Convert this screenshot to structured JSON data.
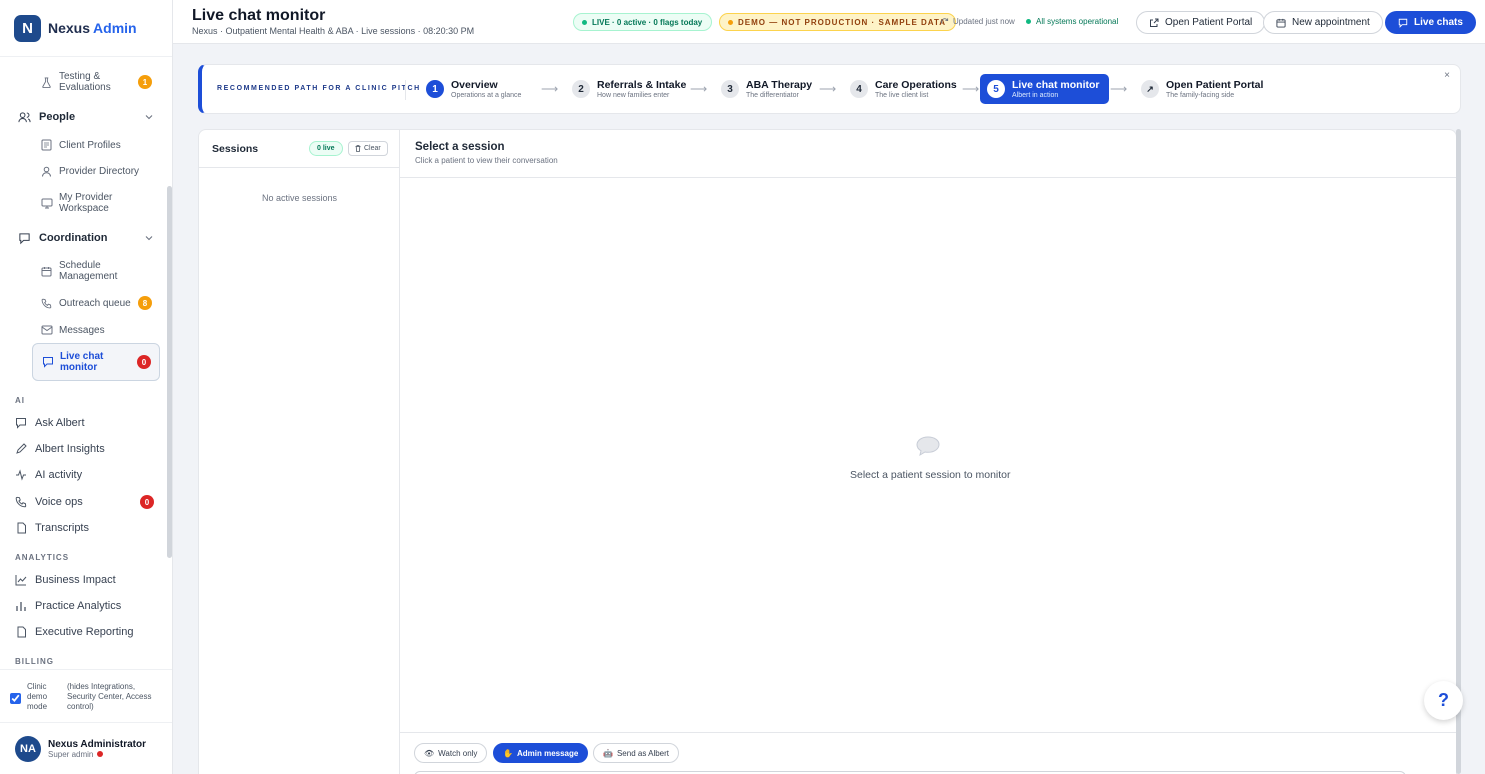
{
  "brand": {
    "logo_letter": "N",
    "name": "Nexus",
    "accent": "Admin"
  },
  "sidebar": {
    "testing": {
      "label": "Testing & Evaluations",
      "badge": "1"
    },
    "people": {
      "label": "People",
      "items": [
        {
          "label": "Client Profiles"
        },
        {
          "label": "Provider Directory"
        },
        {
          "label": "My Provider Workspace"
        }
      ]
    },
    "coordination": {
      "label": "Coordination",
      "items": [
        {
          "label": "Schedule Management"
        },
        {
          "label": "Outreach queue",
          "badge": "8"
        },
        {
          "label": "Messages"
        },
        {
          "label": "Live chat monitor",
          "badge": "0"
        }
      ]
    },
    "ai_label": "AI",
    "ai_items": [
      {
        "label": "Ask Albert"
      },
      {
        "label": "Albert Insights"
      },
      {
        "label": "AI activity"
      },
      {
        "label": "Voice ops",
        "badge": "0"
      },
      {
        "label": "Transcripts"
      }
    ],
    "analytics_label": "ANALYTICS",
    "analytics_items": [
      {
        "label": "Business Impact"
      },
      {
        "label": "Practice Analytics"
      },
      {
        "label": "Executive Reporting"
      }
    ],
    "billing_label": "BILLING",
    "demo_mode": {
      "label": "Clinic demo mode",
      "note": "(hides Integrations, Security Center, Access control)",
      "checked": true
    },
    "user": {
      "name": "Nexus Administrator",
      "role": "Super admin",
      "initials": "NA"
    }
  },
  "header": {
    "title": "Live chat monitor",
    "subtitle": "Nexus · Outpatient Mental Health & ABA · Live sessions · 08:20:30 PM",
    "live_pill": "LIVE · 0 active · 0 flags today",
    "demo_pill": "DEMO — NOT PRODUCTION · SAMPLE DATA",
    "updated": "Updated",
    "updated_when": "just now",
    "systems": "All systems operational",
    "buttons": {
      "portal": "Open Patient Portal",
      "appointment": "New appointment",
      "chats": "Live chats"
    }
  },
  "pitch": {
    "label": "RECOMMENDED PATH FOR A CLINIC PITCH",
    "close": "×",
    "steps": [
      {
        "num": "1",
        "title": "Overview",
        "sub": "Operations at a glance"
      },
      {
        "num": "2",
        "title": "Referrals & Intake",
        "sub": "How new families enter"
      },
      {
        "num": "3",
        "title": "ABA Therapy",
        "sub": "The differentiator"
      },
      {
        "num": "4",
        "title": "Care Operations",
        "sub": "The live client list"
      },
      {
        "num": "5",
        "title": "Live chat monitor",
        "sub": "Albert in action"
      },
      {
        "num": "↗",
        "title": "Open Patient Portal",
        "sub": "The family-facing side"
      }
    ]
  },
  "sessions": {
    "title": "Sessions",
    "live_chip": "0 live",
    "clear": "Clear",
    "empty": "No active sessions"
  },
  "conversation": {
    "title": "Select a session",
    "subtitle": "Click a patient to view their conversation",
    "empty": "Select a patient session to monitor",
    "modes": {
      "watch": "Watch only",
      "admin": "Admin message",
      "albert": "Send as Albert"
    }
  },
  "help": "?",
  "colors": {
    "primary": "#1d4ed8",
    "success": "#047857",
    "warning": "#f59e0b",
    "danger": "#dc2626"
  }
}
